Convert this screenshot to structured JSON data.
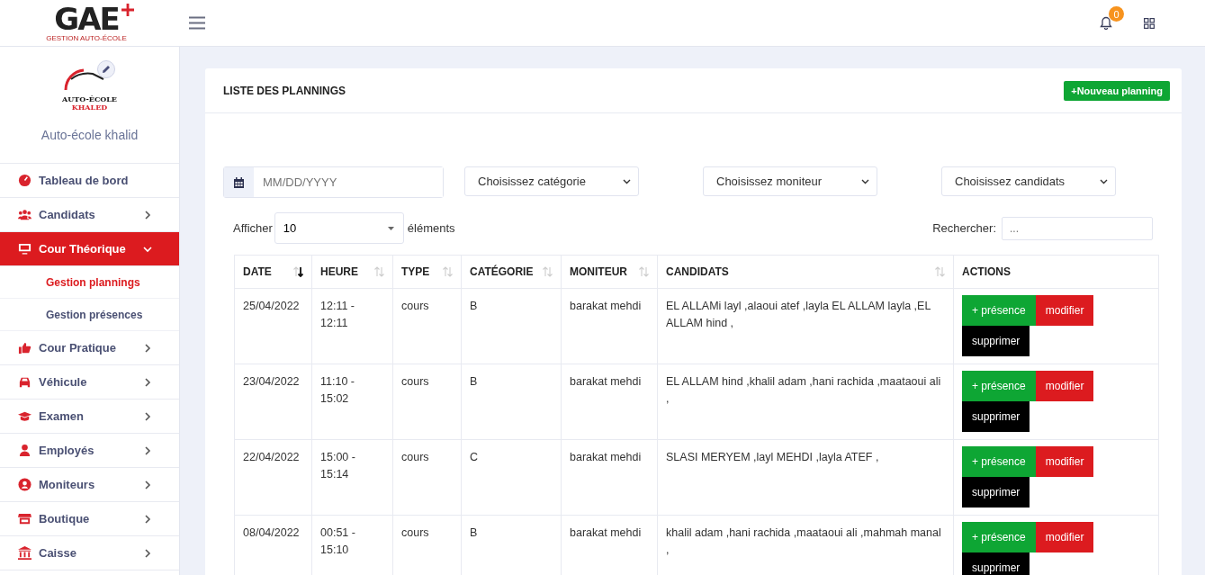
{
  "header": {
    "logo_text": "GAE",
    "logo_subtitle": "GESTION AUTO-ÉCOLE",
    "notification_count": "0"
  },
  "sidebar": {
    "school_logo": {
      "line_1": "AUTO-ÉCOLE",
      "line_2": "KHALED"
    },
    "school_name": "Auto-école khalid",
    "items": [
      {
        "label": "Tableau de bord",
        "kind": "link",
        "selected": false
      },
      {
        "label": "Candidats",
        "kind": "menu",
        "selected": false,
        "expanded": false
      },
      {
        "label": "Cour Théorique",
        "kind": "menu",
        "selected": true,
        "expanded": true,
        "children": [
          {
            "label": "Gestion plannings",
            "selected": true
          },
          {
            "label": "Gestion présences",
            "selected": false
          }
        ]
      },
      {
        "label": "Cour Pratique",
        "kind": "menu",
        "selected": false,
        "expanded": false
      },
      {
        "label": "Véhicule",
        "kind": "menu",
        "selected": false,
        "expanded": false
      },
      {
        "label": "Examen",
        "kind": "menu",
        "selected": false,
        "expanded": false
      },
      {
        "label": "Employés",
        "kind": "menu",
        "selected": false,
        "expanded": false
      },
      {
        "label": "Moniteurs",
        "kind": "menu",
        "selected": false,
        "expanded": false
      },
      {
        "label": "Boutique",
        "kind": "menu",
        "selected": false,
        "expanded": false
      },
      {
        "label": "Caisse",
        "kind": "menu",
        "selected": false,
        "expanded": false
      }
    ]
  },
  "card": {
    "title": "LISTE DES PLANNINGS",
    "new_button": "+Nouveau planning"
  },
  "filters": {
    "date_placeholder": "MM/DD/YYYY",
    "selects": [
      "Choisissez catégorie",
      "Choisissez moniteur",
      "Choisissez candidats"
    ]
  },
  "table_controls": {
    "show_label": "Afficher",
    "page_size": "10",
    "elements_label": "éléments",
    "search_label": "Rechercher:",
    "search_placeholder": "..."
  },
  "table": {
    "columns": [
      {
        "label": "DATE",
        "sortable": true,
        "sorted_desc": true
      },
      {
        "label": "HEURE",
        "sortable": true,
        "sorted_desc": false
      },
      {
        "label": "TYPE",
        "sortable": true,
        "sorted_desc": false
      },
      {
        "label": "CATÉGORIE",
        "sortable": true,
        "sorted_desc": false
      },
      {
        "label": "MONITEUR",
        "sortable": true,
        "sorted_desc": false
      },
      {
        "label": "CANDIDATS",
        "sortable": true,
        "sorted_desc": false
      },
      {
        "label": "ACTIONS",
        "sortable": false
      }
    ],
    "rows": [
      {
        "cells": [
          "25/04/2022",
          "12:11 - 12:11",
          "cours",
          "B",
          "barakat mehdi",
          "EL ALLAMi layl ,alaoui atef ,layla EL ALLAM layla ,EL ALLAM hind ,"
        ],
        "actions": [
          {
            "label": "+ présence",
            "kind": "success"
          },
          {
            "label": "modifier",
            "kind": "danger"
          },
          {
            "label": "supprimer",
            "kind": "dark"
          }
        ]
      },
      {
        "cells": [
          "23/04/2022",
          "11:10 - 15:02",
          "cours",
          "B",
          "barakat mehdi",
          "EL ALLAM hind ,khalil adam ,hani rachida ,maataoui ali ,"
        ],
        "actions": [
          {
            "label": "+ présence",
            "kind": "success"
          },
          {
            "label": "modifier",
            "kind": "danger"
          },
          {
            "label": "supprimer",
            "kind": "dark"
          }
        ]
      },
      {
        "cells": [
          "22/04/2022",
          "15:00 - 15:14",
          "cours",
          "C",
          "barakat mehdi",
          "SLASI MERYEM ,layl MEHDI ,layla ATEF ,"
        ],
        "actions": [
          {
            "label": "+ présence",
            "kind": "success"
          },
          {
            "label": "modifier",
            "kind": "danger"
          },
          {
            "label": "supprimer",
            "kind": "dark"
          }
        ]
      },
      {
        "cells": [
          "08/04/2022",
          "00:51 - 15:10",
          "cours",
          "B",
          "barakat mehdi",
          "khalil adam ,hani rachida ,maataoui ali ,mahmah manal ,"
        ],
        "actions": [
          {
            "label": "+ présence",
            "kind": "success"
          },
          {
            "label": "modifier",
            "kind": "danger"
          },
          {
            "label": "supprimer",
            "kind": "dark"
          }
        ]
      }
    ]
  }
}
